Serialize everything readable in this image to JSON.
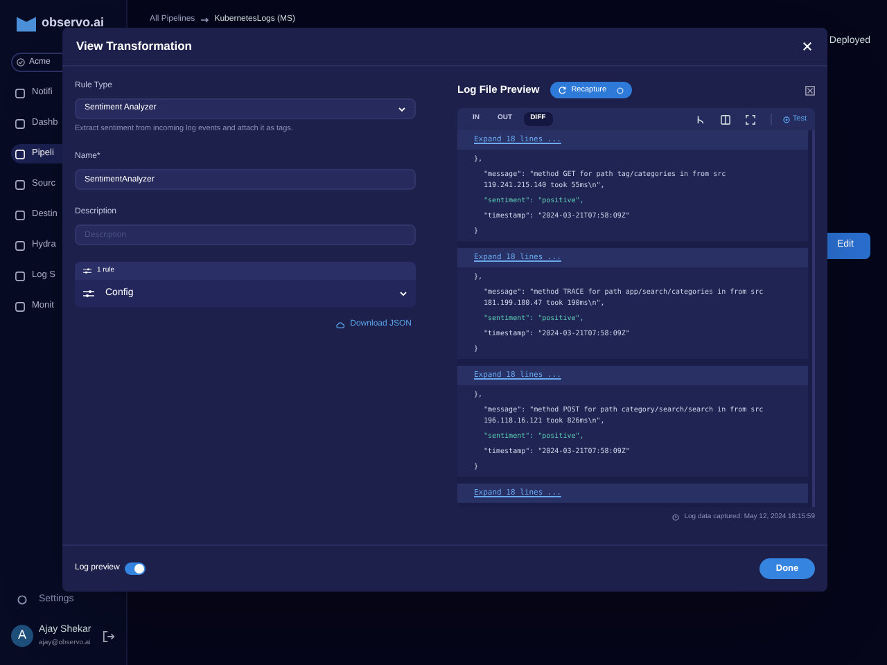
{
  "app": {
    "logo": "observo.ai",
    "breadcrumb": [
      "All Pipelines",
      "KubernetesLogs (MS)"
    ],
    "org": "Acme",
    "status": "Deployed",
    "edit_button": "Edit",
    "nav": [
      {
        "label": "Notifi",
        "selected": false
      },
      {
        "label": "Dashb",
        "selected": false
      },
      {
        "label": "Pipeli",
        "selected": true
      },
      {
        "label": "Sourc",
        "selected": false
      },
      {
        "label": "Destin",
        "selected": false
      },
      {
        "label": "Hydra",
        "selected": false
      },
      {
        "label": "Log S",
        "selected": false
      },
      {
        "label": "Monit",
        "selected": false
      }
    ],
    "settings": "Settings",
    "user": {
      "initial": "A",
      "name": "Ajay Shekar",
      "email": "ajay@observo.ai"
    }
  },
  "dialog": {
    "title": "View Transformation",
    "rule_type": {
      "label": "Rule Type",
      "value": "Sentiment Analyzer",
      "hint": "Extract sentiment from incoming log events and attach it as tags."
    },
    "name": {
      "label": "Name*",
      "value": "SentimentAnalyzer"
    },
    "description": {
      "label": "Description",
      "placeholder": "Description"
    },
    "rules": {
      "count": "1 rule",
      "item": "Config"
    },
    "download": "Download JSON",
    "preview": {
      "title": "Log File Preview",
      "recapture": "Recapture",
      "tabs": [
        {
          "label": "IN",
          "selected": false
        },
        {
          "label": "OUT",
          "selected": false
        },
        {
          "label": "DIFF",
          "selected": true
        }
      ],
      "test": "Test",
      "hunks": [
        {
          "expand": "Expand 18 lines ...",
          "lines": [
            {
              "text": "},",
              "added": false
            },
            {
              "text": "\"message\": \"method GET for path tag/categories in from src 119.241.215.140 took 55ms\\n\",",
              "added": false
            },
            {
              "text": "\"sentiment\": \"positive\",",
              "added": true
            },
            {
              "text": "\"timestamp\": \"2024-03-21T07:58:09Z\"",
              "added": false
            },
            {
              "text": "}",
              "added": false
            }
          ]
        },
        {
          "expand": "Expand 18 lines ...",
          "lines": [
            {
              "text": "},",
              "added": false
            },
            {
              "text": "\"message\": \"method TRACE for path app/search/categories in from src 181.199.180.47 took 190ms\\n\",",
              "added": false
            },
            {
              "text": "\"sentiment\": \"positive\",",
              "added": true
            },
            {
              "text": "\"timestamp\": \"2024-03-21T07:58:09Z\"",
              "added": false
            },
            {
              "text": "}",
              "added": false
            }
          ]
        },
        {
          "expand": "Expand 18 lines ...",
          "lines": [
            {
              "text": "},",
              "added": false
            },
            {
              "text": "\"message\": \"method POST for path category/search/search in from src 196.118.16.121 took 826ms\\n\",",
              "added": false
            },
            {
              "text": "\"sentiment\": \"positive\",",
              "added": true
            },
            {
              "text": "\"timestamp\": \"2024-03-21T07:58:09Z\"",
              "added": false
            },
            {
              "text": "}",
              "added": false
            }
          ]
        },
        {
          "expand": "Expand 18 lines ..."
        }
      ],
      "captured": "Log data captured: May 12, 2024 18:15:59"
    },
    "log_preview": {
      "label": "Log preview",
      "on": true
    },
    "done": "Done"
  }
}
